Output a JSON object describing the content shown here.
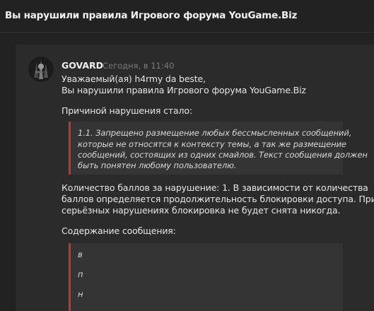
{
  "header": {
    "title": "Вы нарушили правила Игрового форума YouGame.Biz"
  },
  "message": {
    "author": "GOVARD",
    "timestamp": "Сегодня, в 11:40",
    "greeting": "Уважаемый(ая) h4rmy da beste,",
    "notice": "Вы нарушили правила Игрового форума YouGame.Biz",
    "reason_label": "Причиной нарушения стало:",
    "rule_lines": [
      "1.1. Запрещено размещение любых бессмысленных сообщений,",
      "которые не относятся к контексту темы, а так же размещение",
      "сообщений, состоящих из одних смайлов. Текст сообщения должен",
      "быть понятен любому пользователю."
    ],
    "points_lines": [
      "Количество баллов за нарушение: 1. В зависимости от количества",
      "баллов определяется продолжительность блокировки доступа. При",
      "серьёзных нарушениях блокировка не будет снята никогда."
    ],
    "content_label": "Содержание сообщения:",
    "content_lines": [
      "в",
      "п",
      "н"
    ]
  },
  "colors": {
    "accent": "#c0392b",
    "background": "#222222",
    "panel": "#2b2b2b"
  }
}
